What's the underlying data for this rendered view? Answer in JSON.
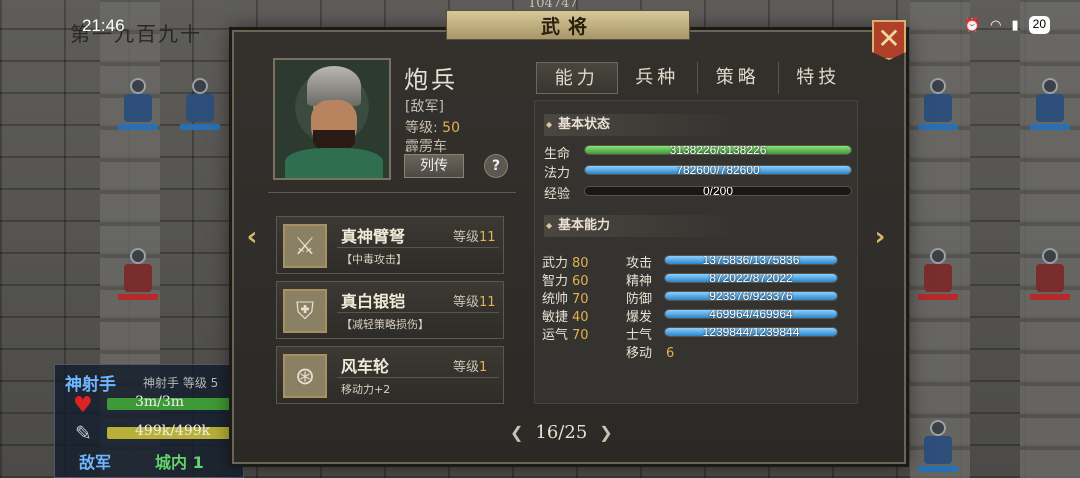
{
  "status_bar": {
    "time": "21:46",
    "battery": "20"
  },
  "background": {
    "top_number": "104747",
    "title_fragment": "第一九百九十"
  },
  "unit_panel": {
    "name": "神射手",
    "info": "神射手  等级 5",
    "hp": "3m/3m",
    "mp": "499k/499k",
    "side": "敌军",
    "location": "城内 1"
  },
  "dialog": {
    "title": "武将",
    "close_icon": "close-x-icon",
    "general": {
      "name": "炮兵",
      "faction": "[敌军]",
      "level_label": "等级:",
      "level_value": "50",
      "unit_type": "霹雳车",
      "bio_button": "列传",
      "help_button": "?"
    },
    "equipment": [
      {
        "name": "真神臂弩",
        "level_label": "等级",
        "level": "11",
        "desc": "【中毒攻击】",
        "icon": "crossbow-icon"
      },
      {
        "name": "真白银铠",
        "level_label": "等级",
        "level": "11",
        "desc": "【减轻策略损伤】",
        "icon": "armor-icon"
      },
      {
        "name": "风车轮",
        "level_label": "等级",
        "level": "1",
        "desc": "移动力+2",
        "icon": "wheel-icon"
      }
    ],
    "pager": {
      "current": "16",
      "total": "25",
      "text": "16/25"
    },
    "tabs": [
      {
        "label": "能力",
        "active": true
      },
      {
        "label": "兵种",
        "active": false
      },
      {
        "label": "策略",
        "active": false
      },
      {
        "label": "特技",
        "active": false
      }
    ],
    "basic_status": {
      "title": "基本状态",
      "hp": {
        "label": "生命",
        "text": "3138226/3138226",
        "ratio": 1.0
      },
      "mp": {
        "label": "法力",
        "text": "782600/782600",
        "ratio": 1.0
      },
      "exp": {
        "label": "经验",
        "text": "0/200",
        "ratio": 0.0
      }
    },
    "basic_ability": {
      "title": "基本能力",
      "attributes": [
        {
          "label": "武力",
          "value": "80"
        },
        {
          "label": "智力",
          "value": "60"
        },
        {
          "label": "统帅",
          "value": "70"
        },
        {
          "label": "敏捷",
          "value": "40"
        },
        {
          "label": "运气",
          "value": "70"
        }
      ],
      "combat": [
        {
          "label": "攻击",
          "text": "1375836/1375836",
          "ratio": 1.0
        },
        {
          "label": "精神",
          "text": "872022/872022",
          "ratio": 1.0
        },
        {
          "label": "防御",
          "text": "923376/923376",
          "ratio": 1.0
        },
        {
          "label": "爆发",
          "text": "469964/469964",
          "ratio": 1.0
        },
        {
          "label": "士气",
          "text": "1239844/1239844",
          "ratio": 1.0
        }
      ],
      "move": {
        "label": "移动",
        "value": "6"
      }
    }
  }
}
